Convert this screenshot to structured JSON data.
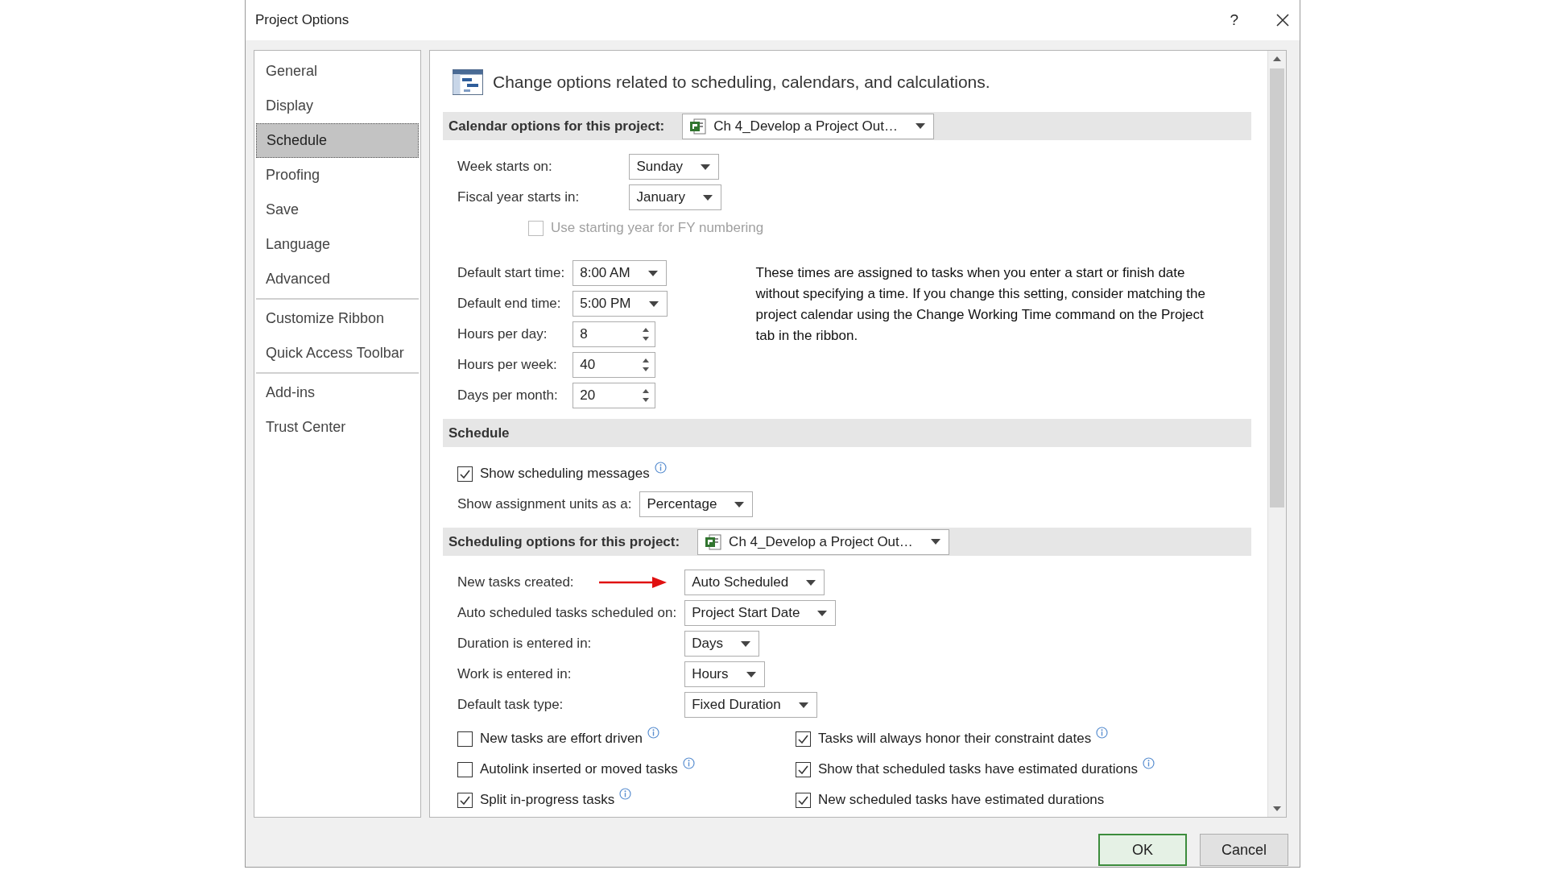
{
  "window": {
    "title": "Project Options",
    "help": "?"
  },
  "sidebar": {
    "groups": [
      {
        "items": [
          {
            "label": "General",
            "selected": false
          },
          {
            "label": "Display",
            "selected": false
          },
          {
            "label": "Schedule",
            "selected": true
          },
          {
            "label": "Proofing",
            "selected": false
          },
          {
            "label": "Save",
            "selected": false
          },
          {
            "label": "Language",
            "selected": false
          },
          {
            "label": "Advanced",
            "selected": false
          }
        ]
      },
      {
        "items": [
          {
            "label": "Customize Ribbon",
            "selected": false
          },
          {
            "label": "Quick Access Toolbar",
            "selected": false
          }
        ]
      },
      {
        "items": [
          {
            "label": "Add-ins",
            "selected": false
          },
          {
            "label": "Trust Center",
            "selected": false
          }
        ]
      }
    ]
  },
  "header": "Change options related to scheduling, calendars, and calculations.",
  "sections": [
    {
      "title": "Calendar options for this project:",
      "project": "Ch 4_Develop a Project Out…",
      "groups": [
        {
          "rows": [
            {
              "kind": "dropdown",
              "label": "Week starts on:",
              "value": "Sunday"
            },
            {
              "kind": "dropdown",
              "label": "Fiscal year starts in:",
              "value": "January"
            }
          ],
          "sub_option": {
            "label": "Use starting year for FY numbering",
            "checked": false,
            "disabled": true
          }
        },
        {
          "rows": [
            {
              "kind": "dropdown",
              "label": "Default start time:",
              "value": "8:00 AM"
            },
            {
              "kind": "dropdown",
              "label": "Default end time:",
              "value": "5:00 PM"
            },
            {
              "kind": "spin",
              "label": "Hours per day:",
              "value": "8"
            },
            {
              "kind": "spin",
              "label": "Hours per week:",
              "value": "40"
            },
            {
              "kind": "spin",
              "label": "Days per month:",
              "value": "20"
            }
          ],
          "note": "These times are assigned to tasks when you enter a start or finish date without specifying a time. If you change this setting, consider matching the project calendar using the Change Working Time command on the Project tab in the ribbon."
        }
      ]
    },
    {
      "title": "Schedule",
      "groups": [
        {
          "rows": [
            {
              "kind": "checkbox",
              "label": "Show scheduling messages",
              "checked": true,
              "disabled": false,
              "info": true
            },
            {
              "kind": "dropdown",
              "label": "Show assignment units as a:",
              "value": "Percentage"
            }
          ]
        }
      ]
    },
    {
      "title": "Scheduling options for this project:",
      "project": "Ch 4_Develop a Project Out…",
      "groups": [
        {
          "rows": [
            {
              "kind": "dropdown",
              "label": "New tasks created:",
              "value": "Auto Scheduled",
              "pointer": true
            },
            {
              "kind": "dropdown",
              "label": "Auto scheduled tasks scheduled on:",
              "value": "Project Start Date",
              "pointer": false
            },
            {
              "kind": "dropdown",
              "label": "Duration is entered in:",
              "value": "Days",
              "pointer": false
            },
            {
              "kind": "dropdown",
              "label": "Work is entered in:",
              "value": "Hours",
              "pointer": false
            },
            {
              "kind": "dropdown",
              "label": "Default task type:",
              "value": "Fixed Duration",
              "pointer": false
            }
          ]
        }
      ],
      "check_columns": [
        [
          {
            "label": "New tasks are effort driven",
            "checked": false,
            "info": true
          },
          {
            "label": "Autolink inserted or moved tasks",
            "checked": false,
            "info": true
          },
          {
            "label": "Split in-progress tasks",
            "checked": true,
            "info": true
          }
        ],
        [
          {
            "label": "Tasks will always honor their constraint dates",
            "checked": true,
            "info": true
          },
          {
            "label": "Show that scheduled tasks have estimated durations",
            "checked": true,
            "info": true
          },
          {
            "label": "New scheduled tasks have estimated durations",
            "checked": true,
            "info": false
          }
        ]
      ]
    }
  ],
  "buttons": [
    {
      "label": "OK",
      "default": true
    },
    {
      "label": "Cancel",
      "default": false
    }
  ]
}
